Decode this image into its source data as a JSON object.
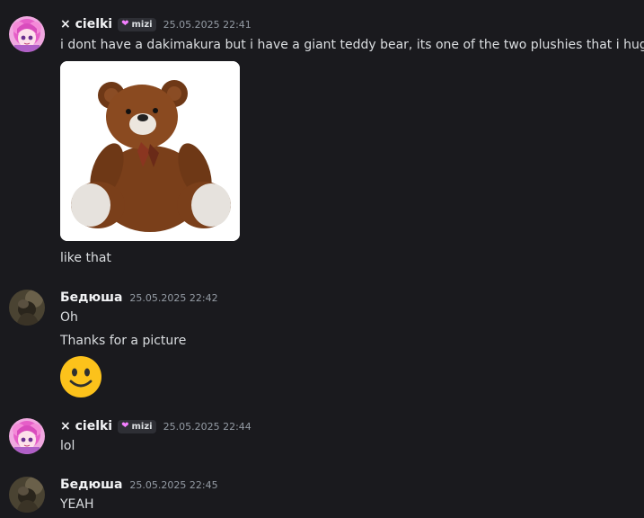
{
  "messages": [
    {
      "author": "× cielki",
      "tag": "mizi",
      "timestamp": "25.05.2025 22:41",
      "lines": [
        "i dont have a dakimakura but i have a giant teddy bear, its one of the two plushies that i hug",
        "like that"
      ],
      "attachment": "teddy-bear-image"
    },
    {
      "author": "Бедюша",
      "timestamp": "25.05.2025 22:42",
      "lines": [
        "Oh",
        "Thanks for a picture"
      ],
      "emoji": "slightly-smiling-face"
    },
    {
      "author": "× cielki",
      "tag": "mizi",
      "timestamp": "25.05.2025 22:44",
      "lines": [
        "lol"
      ]
    },
    {
      "author": "Бедюша",
      "timestamp": "25.05.2025 22:45",
      "lines": [
        "YEAH"
      ]
    }
  ],
  "colors": {
    "background": "#1a1a1e",
    "username": "#f2f3f5",
    "text": "#dbdee1",
    "timestamp": "#949ba4",
    "tag_heart": "#f47fff"
  }
}
